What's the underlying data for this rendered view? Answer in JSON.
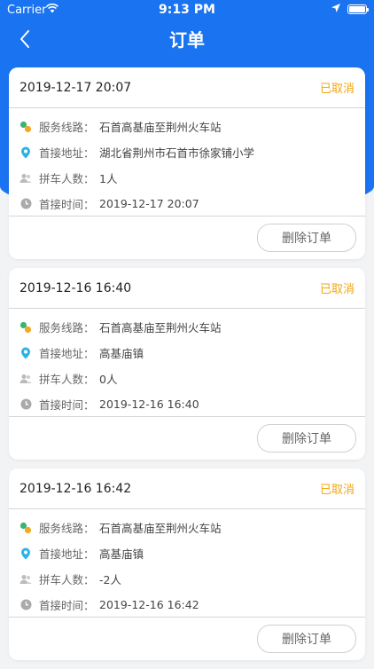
{
  "status_bar": {
    "carrier": "Carrier",
    "time": "9:13 PM"
  },
  "nav": {
    "title": "订单"
  },
  "labels": {
    "route": "服务线路：",
    "address": "首接地址：",
    "passengers": "拼车人数：",
    "pickup_time": "首接时间："
  },
  "colors": {
    "primary": "#1a73f0",
    "status_cancelled": "#f2a60f"
  },
  "orders": [
    {
      "date": "2019-12-17 20:07",
      "status": "已取消",
      "route": "石首高基庙至荆州火车站",
      "address": "湖北省荆州市石首市徐家铺小学",
      "passengers": "1人",
      "pickup_time": "2019-12-17 20:07",
      "delete_label": "删除订单"
    },
    {
      "date": "2019-12-16 16:40",
      "status": "已取消",
      "route": "石首高基庙至荆州火车站",
      "address": "高基庙镇",
      "passengers": "0人",
      "pickup_time": "2019-12-16 16:40",
      "delete_label": "删除订单"
    },
    {
      "date": "2019-12-16 16:42",
      "status": "已取消",
      "route": "石首高基庙至荆州火车站",
      "address": "高基庙镇",
      "passengers": "-2人",
      "pickup_time": "2019-12-16 16:42",
      "delete_label": "删除订单"
    }
  ]
}
